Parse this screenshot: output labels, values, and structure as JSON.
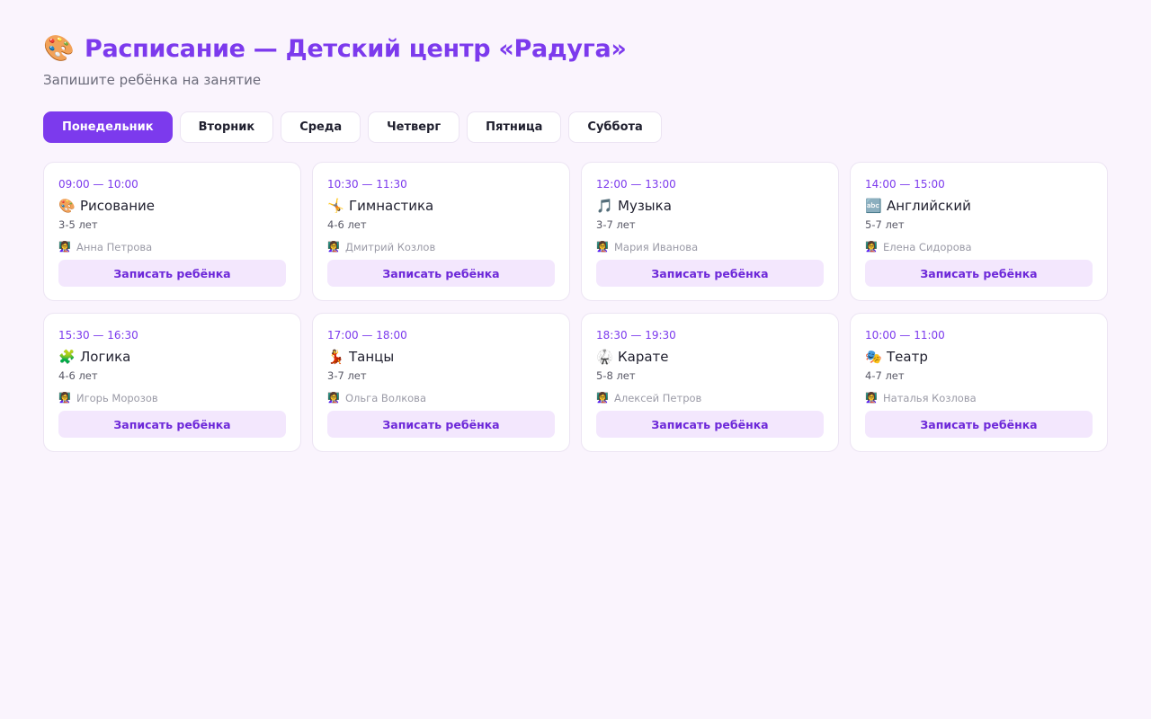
{
  "header": {
    "icon": "palette-icon",
    "icon_glyph": "🎨",
    "title": "Расписание — Детский центр «Радуга»",
    "subtitle": "Запишите ребёнка на занятие"
  },
  "tabs": [
    {
      "label": "Понедельник",
      "active": true
    },
    {
      "label": "Вторник",
      "active": false
    },
    {
      "label": "Среда",
      "active": false
    },
    {
      "label": "Четверг",
      "active": false
    },
    {
      "label": "Пятница",
      "active": false
    },
    {
      "label": "Суббота",
      "active": false
    }
  ],
  "enroll_label": "Записать ребёнка",
  "classes": [
    {
      "time": "09:00 — 10:00",
      "icon": "palette-icon",
      "glyph": "🎨",
      "name": "Рисование",
      "age": "3-5 лет",
      "teacher_icon": "teacher-icon",
      "teacher_glyph": "👩‍🏫",
      "teacher": "Анна Петрова"
    },
    {
      "time": "10:30 — 11:30",
      "icon": "gymnast-icon",
      "glyph": "🤸",
      "name": "Гимнастика",
      "age": "4-6 лет",
      "teacher_icon": "teacher-icon",
      "teacher_glyph": "👩‍🏫",
      "teacher": "Дмитрий Козлов"
    },
    {
      "time": "12:00 — 13:00",
      "icon": "music-note-icon",
      "glyph": "🎵",
      "name": "Музыка",
      "age": "3-7 лет",
      "teacher_icon": "teacher-icon",
      "teacher_glyph": "👩‍🏫",
      "teacher": "Мария Иванова"
    },
    {
      "time": "14:00 — 15:00",
      "icon": "abc-icon",
      "glyph": "🔤",
      "name": "Английский",
      "age": "5-7 лет",
      "teacher_icon": "teacher-icon",
      "teacher_glyph": "👩‍🏫",
      "teacher": "Елена Сидорова"
    },
    {
      "time": "15:30 — 16:30",
      "icon": "puzzle-icon",
      "glyph": "🧩",
      "name": "Логика",
      "age": "4-6 лет",
      "teacher_icon": "teacher-icon",
      "teacher_glyph": "👩‍🏫",
      "teacher": "Игорь Морозов"
    },
    {
      "time": "17:00 — 18:00",
      "icon": "dancer-icon",
      "glyph": "💃",
      "name": "Танцы",
      "age": "3-7 лет",
      "teacher_icon": "teacher-icon",
      "teacher_glyph": "👩‍🏫",
      "teacher": "Ольга Волкова"
    },
    {
      "time": "18:30 — 19:30",
      "icon": "martial-arts-icon",
      "glyph": "🥋",
      "name": "Карате",
      "age": "5-8 лет",
      "teacher_icon": "teacher-icon",
      "teacher_glyph": "👩‍🏫",
      "teacher": "Алексей Петров"
    },
    {
      "time": "10:00 — 11:00",
      "icon": "theater-masks-icon",
      "glyph": "🎭",
      "name": "Театр",
      "age": "4-7 лет",
      "teacher_icon": "teacher-icon",
      "teacher_glyph": "👩‍🏫",
      "teacher": "Наталья Козлова"
    }
  ],
  "colors": {
    "accent": "#7c3aed",
    "background": "#faf4fd",
    "button_bg": "#f3e7fd"
  }
}
